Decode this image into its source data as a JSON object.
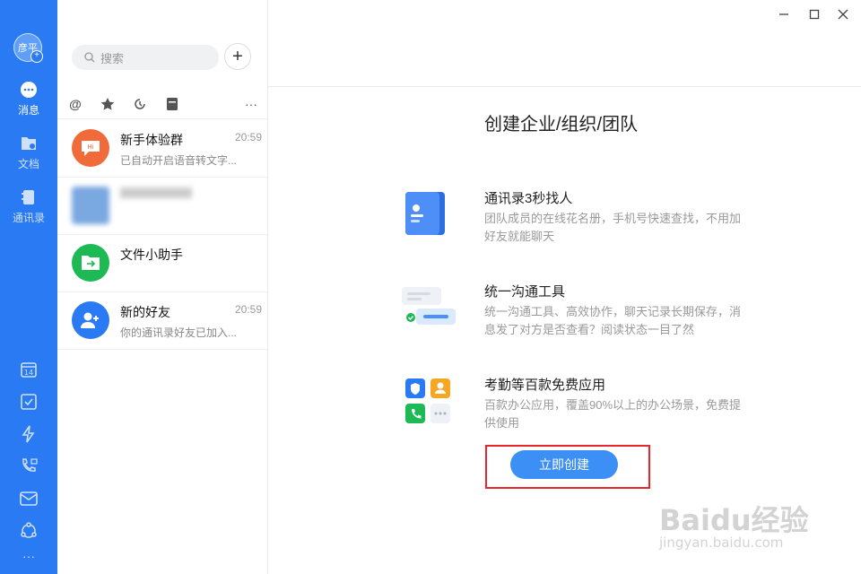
{
  "nav": {
    "avatar_text": "彦平",
    "items": [
      {
        "label": "消息",
        "icon": "message-icon"
      },
      {
        "label": "文档",
        "icon": "document-icon"
      },
      {
        "label": "通讯录",
        "icon": "contacts-icon"
      }
    ],
    "tools": [
      "calendar-icon",
      "todo-icon",
      "lightning-icon",
      "phone-icon",
      "mail-icon",
      "workspace-icon",
      "more-icon"
    ],
    "calendar_day": "14",
    "more_label": "···"
  },
  "search": {
    "placeholder": "搜索"
  },
  "filters": {
    "at_label": "@",
    "more_label": "···"
  },
  "chats": [
    {
      "name": "新手体验群",
      "time": "20:59",
      "msg": "已自动开启语音转文字..."
    },
    {
      "name": "",
      "time": "",
      "msg": ""
    },
    {
      "name": "文件小助手",
      "time": "",
      "msg": ""
    },
    {
      "name": "新的好友",
      "time": "20:59",
      "msg": "你的通讯录好友已加入..."
    }
  ],
  "main": {
    "title": "创建企业/组织/团队",
    "features": [
      {
        "title": "通讯录3秒找人",
        "desc": "团队成员的在线花名册，手机号快速查找，不用加好友就能聊天"
      },
      {
        "title": "统一沟通工具",
        "desc": "统一沟通工具、高效协作，聊天记录长期保存，消息发了对方是否查看？阅读状态一目了然"
      },
      {
        "title": "考勤等百款免费应用",
        "desc": "百款办公应用，覆盖90%以上的办公场景，免费提供使用"
      }
    ],
    "create_button": "立即创建"
  },
  "watermark": {
    "brand": "Baidu经验",
    "url": "jingyan.baidu.com"
  },
  "colors": {
    "nav": "#2a7af3",
    "button": "#3b8ff5",
    "highlight": "#e8262b"
  }
}
